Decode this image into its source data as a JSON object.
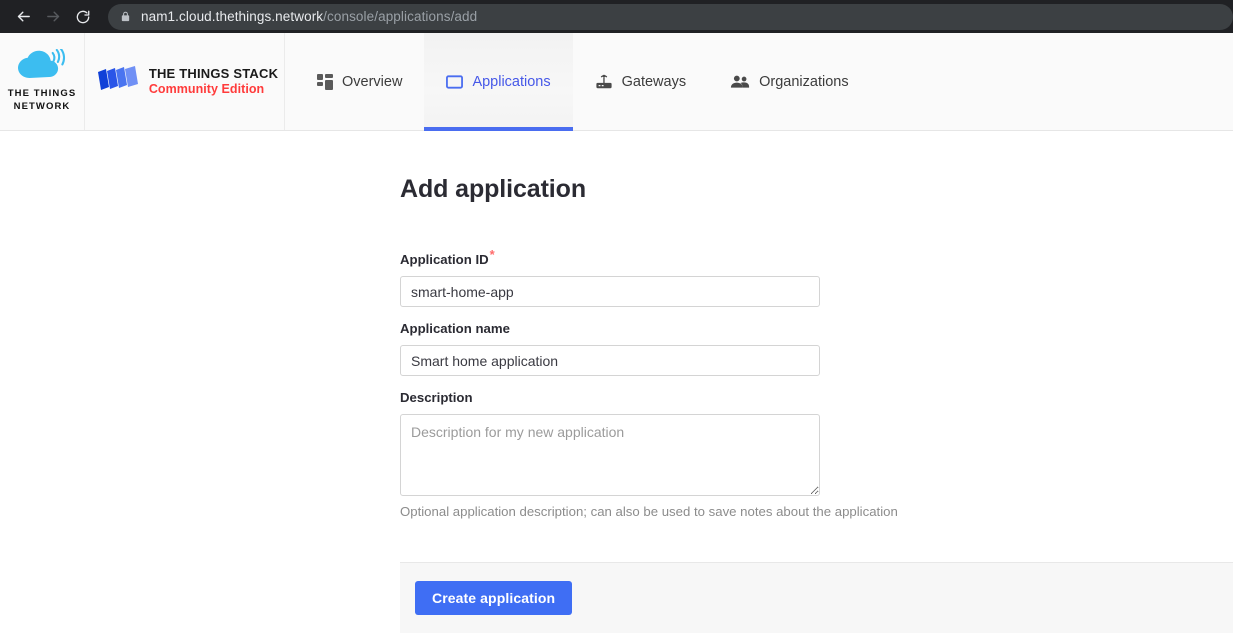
{
  "browser": {
    "back_icon": "arrow-left-icon",
    "forward_icon": "arrow-right-icon",
    "reload_icon": "reload-icon",
    "lock_icon": "lock-icon",
    "url_domain": "nam1.cloud.thethings.network",
    "url_path": "/console/applications/add"
  },
  "header": {
    "brand_ttn": {
      "icon": "cloud-signal-icon",
      "line1": "THE THINGS",
      "line2": "NETWORK"
    },
    "brand_stack": {
      "icon": "stack-layers-icon",
      "title": "THE THINGS STACK",
      "subtitle": "Community Edition",
      "subtitle_color": "#ff3b3b"
    },
    "nav": [
      {
        "label": "Overview",
        "icon": "grid-icon",
        "active": false
      },
      {
        "label": "Applications",
        "icon": "application-window-icon",
        "active": true
      },
      {
        "label": "Gateways",
        "icon": "gateway-router-icon",
        "active": false
      },
      {
        "label": "Organizations",
        "icon": "organizations-people-icon",
        "active": false
      }
    ],
    "active_color": "#4a6df0"
  },
  "main": {
    "page_title": "Add application",
    "fields": [
      {
        "label": "Application ID",
        "required": true,
        "required_marker": "*",
        "value": "smart-home-app",
        "placeholder": "",
        "help": ""
      },
      {
        "label": "Application name",
        "required": false,
        "value": "Smart home application",
        "placeholder": "",
        "help": ""
      },
      {
        "label": "Description",
        "required": false,
        "value": "",
        "placeholder": "Description for my new application",
        "help": "Optional application description; can also be used to save notes about the application"
      }
    ],
    "submit_label": "Create application",
    "submit_color": "#3f6ef4"
  }
}
